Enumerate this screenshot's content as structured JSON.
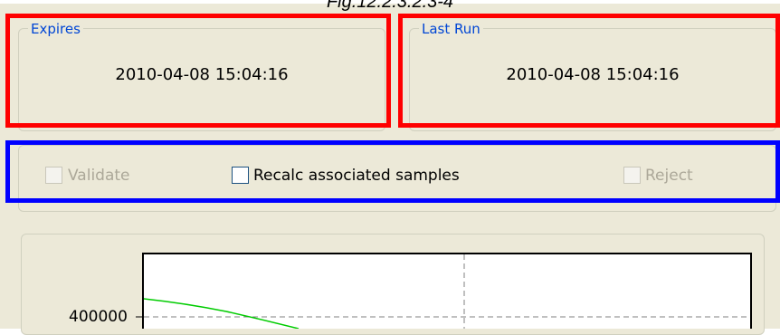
{
  "figure_caption": "Fig.12.2.3.2.3-4",
  "expires": {
    "label": "Expires",
    "value": "2010-04-08 15:04:16"
  },
  "last_run": {
    "label": "Last Run",
    "value": "2010-04-08 15:04:16"
  },
  "actions": {
    "validate": {
      "label": "Validate",
      "enabled": false,
      "checked": false
    },
    "recalc": {
      "label": "Recalc associated samples",
      "enabled": true,
      "checked": false
    },
    "reject": {
      "label": "Reject",
      "enabled": false,
      "checked": false
    }
  },
  "chart": {
    "y_tick_label": "400000"
  },
  "colors": {
    "panel_bg": "#ece9d8",
    "group_label": "#0046d5",
    "highlight_red": "#ff0000",
    "highlight_blue": "#0000ff",
    "curve": "#00cc00"
  }
}
